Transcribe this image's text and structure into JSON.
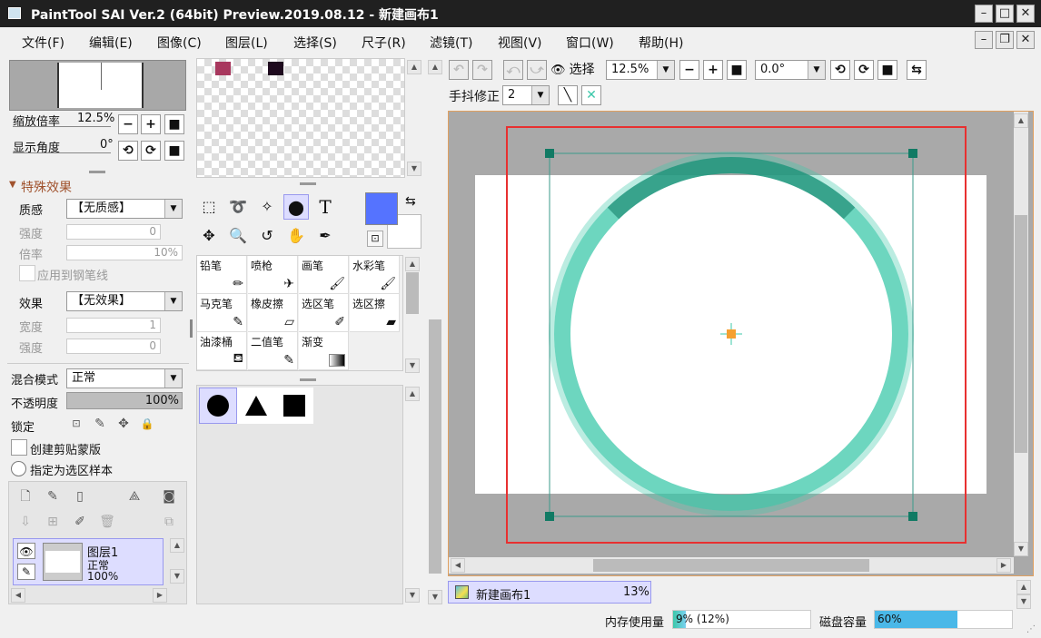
{
  "window": {
    "title": "PaintTool SAI Ver.2 (64bit) Preview.2019.08.12 - 新建画布1"
  },
  "menu": [
    "文件(F)",
    "编辑(E)",
    "图像(C)",
    "图层(L)",
    "选择(S)",
    "尺子(R)",
    "滤镜(T)",
    "视图(V)",
    "窗口(W)",
    "帮助(H)"
  ],
  "navigator": {
    "zoom_label": "缩放倍率",
    "zoom_value": "12.5%",
    "angle_label": "显示角度",
    "angle_value": "0°"
  },
  "effects": {
    "section_title": "特殊效果",
    "texture_label": "质感",
    "texture_value": "【无质感】",
    "strength_label": "强度",
    "strength_value": "0",
    "scale_label": "倍率",
    "scale_value": "10%",
    "apply_pen_label": "应用到钢笔线",
    "effect_label": "效果",
    "effect_value": "【无效果】",
    "width_label": "宽度",
    "width_value": "1",
    "strength2_label": "强度",
    "strength2_value": "0"
  },
  "layer_props": {
    "blend_label": "混合模式",
    "blend_value": "正常",
    "opacity_label": "不透明度",
    "opacity_value": "100%",
    "opacity_fraction": 1.0,
    "lock_label": "锁定",
    "clip_label": "创建剪贴蒙版",
    "selection_source_label": "指定为选区样本"
  },
  "layers": [
    {
      "name": "图层1",
      "mode": "正常",
      "opacity": "100%"
    }
  ],
  "swatches": [
    "#a8385e",
    "#1e0a1e"
  ],
  "colors": {
    "primary": "#5573ff",
    "secondary": "#ffffff",
    "accent_teal": "#3cc8aa",
    "selection_red": "#e83030"
  },
  "brushes": [
    {
      "name": "铅笔"
    },
    {
      "name": "喷枪"
    },
    {
      "name": "画笔"
    },
    {
      "name": "水彩笔"
    },
    {
      "name": "马克笔"
    },
    {
      "name": "橡皮擦"
    },
    {
      "name": "选区笔"
    },
    {
      "name": "选区擦"
    },
    {
      "name": "油漆桶"
    },
    {
      "name": "二值笔"
    },
    {
      "name": "渐变"
    }
  ],
  "toolbar": {
    "select_label": "选择",
    "zoom_value": "12.5%",
    "angle_value": "0.0°",
    "stabilizer_label": "手抖修正",
    "stabilizer_value": "2"
  },
  "tabs": [
    {
      "label": "新建画布1",
      "percent": "13%"
    }
  ],
  "status": {
    "memory_label": "内存使用量",
    "memory_value": "9% (12%)",
    "memory_fraction": 0.09,
    "disk_label": "磁盘容量",
    "disk_value": "60%",
    "disk_fraction": 0.6
  }
}
